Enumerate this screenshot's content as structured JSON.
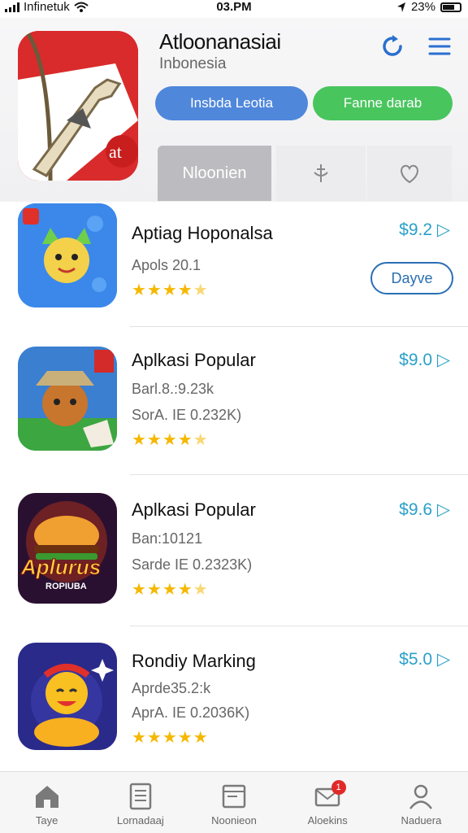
{
  "status_bar": {
    "carrier": "Infinetuk",
    "time": "03.PM",
    "battery": "23%"
  },
  "header": {
    "title": "Atloonanasiai",
    "subtitle": "Inbonesia",
    "primary_button": "Insbda Leotia",
    "secondary_button": "Fanne darab",
    "tab_active": "Nloonien"
  },
  "apps": [
    {
      "name": "Aptiag Hoponalsa",
      "line1": "Apols 20.1",
      "line2": "",
      "rating": 4.5,
      "price": "$9.2 ▷",
      "action": "Dayve"
    },
    {
      "name": "Aplkasi Popular",
      "line1": "Barl.8.:9.23k",
      "line2": "SorA. IE 0.232K)",
      "rating": 4.5,
      "price": "$9.0 ▷"
    },
    {
      "name": "Aplkasi Popular",
      "line1": "Ban:10121",
      "line2": "Sarde IE 0.2323K)",
      "rating": 4.5,
      "price": "$9.6 ▷"
    },
    {
      "name": "Rondiy Marking",
      "line1": "Aprde35.2:k",
      "line2": "AprA. IE 0.2036K)",
      "rating": 5,
      "price": "$5.0 ▷"
    }
  ],
  "icon_labels": {
    "burger_word": "Aplurus",
    "burger_sub": "ROPIUBA"
  },
  "nav": [
    {
      "label": "Taye",
      "icon": "home-icon"
    },
    {
      "label": "Lornadaaj",
      "icon": "document-icon"
    },
    {
      "label": "Noonieon",
      "icon": "folder-icon"
    },
    {
      "label": "Aloekins",
      "icon": "mail-icon",
      "badge": "1"
    },
    {
      "label": "Naduera",
      "icon": "person-icon"
    }
  ],
  "colors": {
    "accent_blue": "#4f87db",
    "accent_green": "#49c55e",
    "price": "#2aa0c8",
    "star": "#f5b800"
  }
}
